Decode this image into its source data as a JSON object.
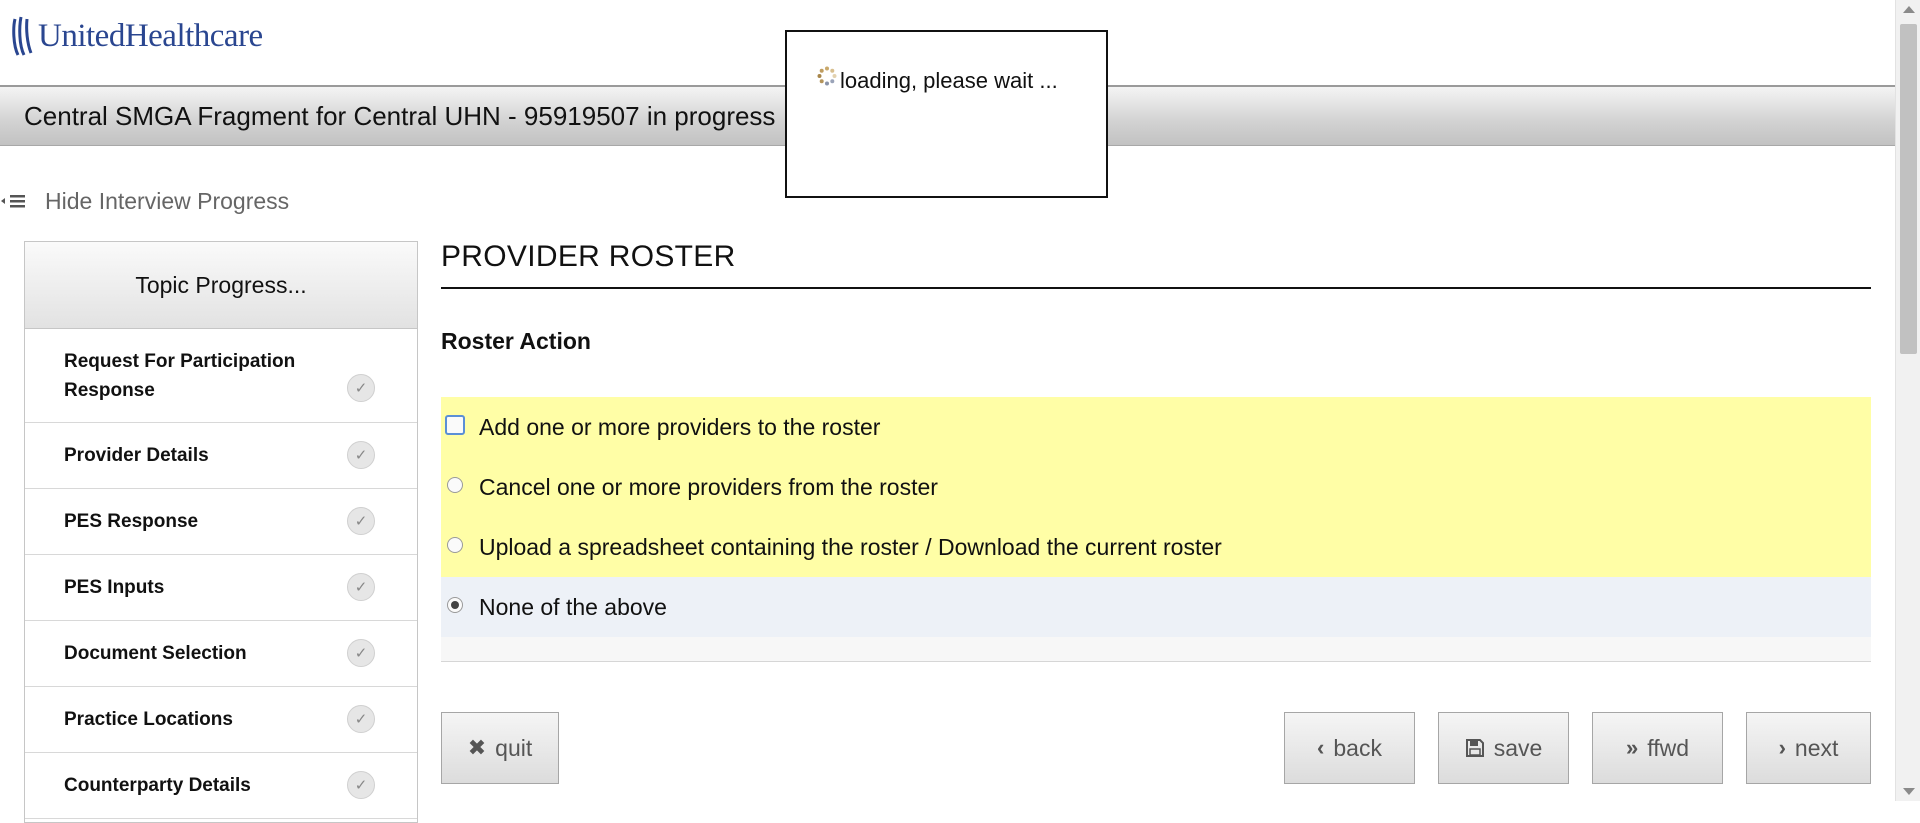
{
  "brand": {
    "name": "UnitedHealthcare",
    "color": "#2a4690"
  },
  "header": {
    "title": "Central SMGA Fragment for Central UHN - 95919507 in progress"
  },
  "loading": {
    "text": "loading, please wait ..."
  },
  "progress_toggle": {
    "label": "Hide Interview Progress",
    "icon": "list-collapse-icon"
  },
  "sidebar": {
    "header": "Topic Progress...",
    "items": [
      {
        "label": "Request For Participation Response",
        "status": "complete"
      },
      {
        "label": "Provider Details",
        "status": "complete"
      },
      {
        "label": "PES Response",
        "status": "complete"
      },
      {
        "label": "PES Inputs",
        "status": "complete"
      },
      {
        "label": "Document Selection",
        "status": "complete"
      },
      {
        "label": "Practice Locations",
        "status": "complete"
      },
      {
        "label": "Counterparty Details",
        "status": "complete"
      }
    ]
  },
  "main": {
    "title": "PROVIDER ROSTER",
    "section_label": "Roster Action",
    "options": [
      {
        "label": "Add one or more providers to the roster",
        "checked": false,
        "highlighted": true,
        "focused": true
      },
      {
        "label": "Cancel one or more providers from the roster",
        "checked": false,
        "highlighted": true,
        "focused": false
      },
      {
        "label": "Upload a spreadsheet containing the roster / Download the current roster",
        "checked": false,
        "highlighted": true,
        "focused": false
      },
      {
        "label": "None of the above",
        "checked": true,
        "highlighted": false,
        "focused": false
      }
    ],
    "highlight_color": "#fffea6"
  },
  "buttons": {
    "quit": {
      "label": "quit",
      "icon": "close-icon"
    },
    "back": {
      "label": "back",
      "icon": "chevron-left-icon"
    },
    "save": {
      "label": "save",
      "icon": "floppy-disk-icon"
    },
    "ffwd": {
      "label": "ffwd",
      "icon": "double-chevron-right-icon"
    },
    "next": {
      "label": "next",
      "icon": "chevron-right-icon"
    }
  }
}
